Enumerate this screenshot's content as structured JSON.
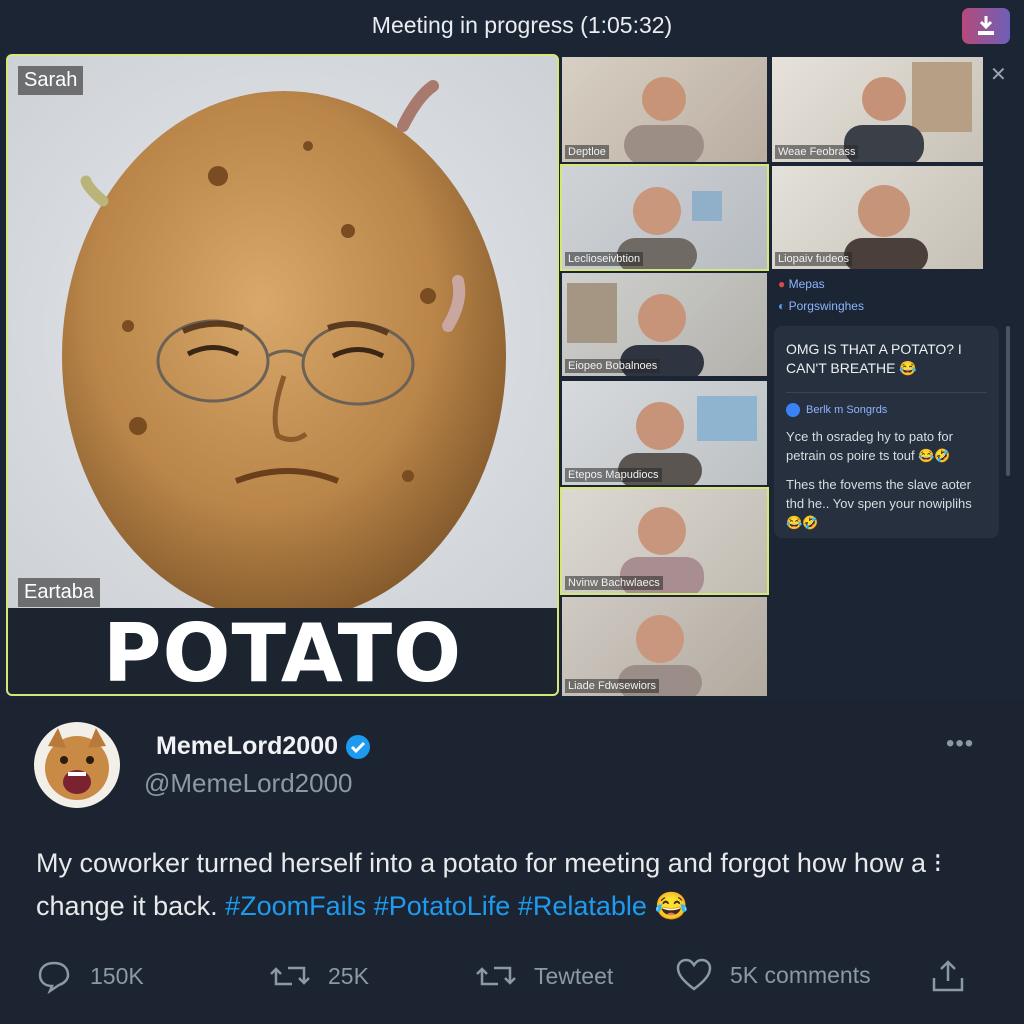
{
  "meeting": {
    "title": "Meeting in progress (1:05:32)",
    "main_participant": {
      "top_label": "Sarah",
      "bottom_label": "Eartaba",
      "overlay_text": "POTATO"
    },
    "tiles": [
      {
        "label": "Deptloe"
      },
      {
        "label": "Weae Feobrass"
      },
      {
        "label": "Leclioseivbtion"
      },
      {
        "label": "Liopaiv fudeos"
      },
      {
        "label": "Eiopeo Bobalnoes"
      },
      {
        "label": "Etepos Mapudiocs"
      },
      {
        "label": "Nvinw Bachwlaecs"
      },
      {
        "label": "Liade Fdwsewiors"
      }
    ],
    "chat": {
      "meta1": "Mepas",
      "meta2": "Porgswinghes",
      "headline": "OMG IS THAT A POTATO? I CAN'T BREATHE 😂",
      "author": "Berlk m Songrds",
      "msg1": "Yce th osradeg hy to pato for petrain os poire ts touf 😂🤣",
      "msg2": "Thes the fovems the slave aoter thd he.. Yov spen your nowiplihs 😂🤣"
    }
  },
  "post": {
    "display_name": "MemeLord2000",
    "handle": "@MemeLord2000",
    "text_main": "My coworker turned herself into a potato for meeting and forgot how how a ⁝ change it back.",
    "hashtags": [
      "#ZoomFails",
      "#PotatoLife",
      "#Relatable"
    ],
    "emoji": "😂",
    "actions": {
      "replies": "150K",
      "retweets": "25K",
      "retweet_label": "Tewteet",
      "likes": "5K comments"
    }
  },
  "colors": {
    "background": "#1c2431",
    "accent": "#1d9bf0",
    "active_border": "#d6e77a"
  }
}
